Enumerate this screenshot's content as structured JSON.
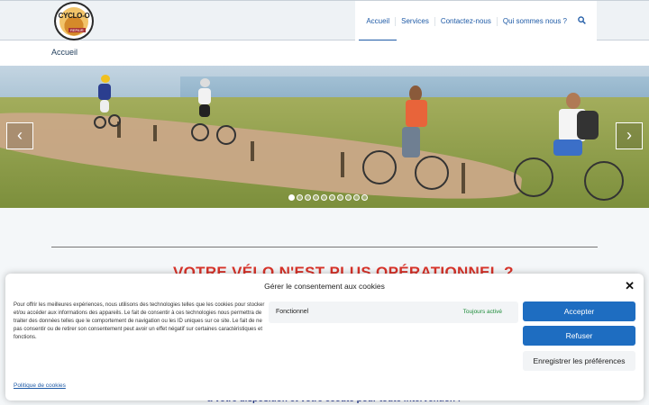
{
  "logo": {
    "text": "CYCLO-O",
    "sub": "REPAIR"
  },
  "nav": {
    "items": [
      "Accueil",
      "Services",
      "Contactez-nous",
      "Qui sommes nous ?"
    ],
    "search_icon": "search-icon"
  },
  "breadcrumb": "Accueil",
  "slider": {
    "prev_icon": "chevron-left-icon",
    "next_icon": "chevron-right-icon",
    "prev_glyph": "‹",
    "next_glyph": "›",
    "dot_count": 10,
    "active_dot": 1
  },
  "main": {
    "headline": "VOTRE VÉLO N'EST PLUS OPÉRATIONNEL ?",
    "subline": "à votre disposition et votre écoute pour toute intervention !"
  },
  "cookie": {
    "title": "Gérer le consentement aux cookies",
    "text": "Pour offrir les meilleures expériences, nous utilisons des technologies telles que les cookies pour stocker et/ou accéder aux informations des appareils. Le fait de consentir à ces technologies nous permettra de traiter des données telles que le comportement de navigation ou les ID uniques sur ce site. Le fait de ne pas consentir ou de retirer son consentement peut avoir un effet négatif sur certaines caractéristiques et fonctions.",
    "functional_label": "Fonctionnel",
    "functional_status": "Toujours activé",
    "accept": "Accepter",
    "refuse": "Refuser",
    "preferences": "Enregistrer les préférences",
    "policy_link": "Politique de cookies",
    "close_glyph": "✕"
  },
  "colors": {
    "accent": "#1e6dc1",
    "headline": "#d8332a",
    "status_green": "#1e8c3a"
  }
}
